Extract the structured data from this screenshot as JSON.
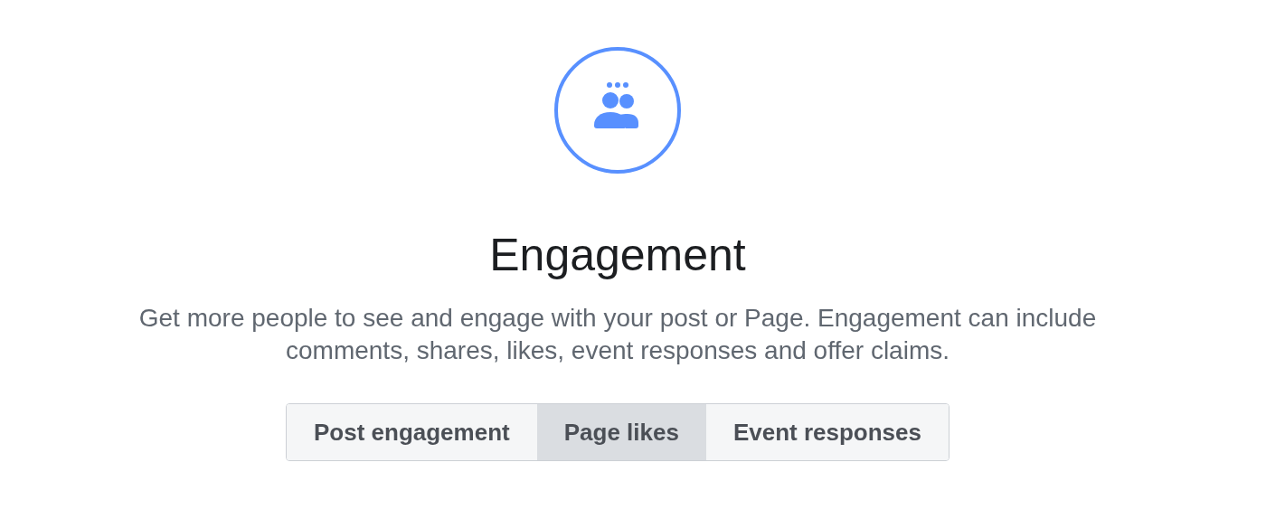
{
  "title": "Engagement",
  "description": "Get more people to see and engage with your post or Page. Engagement can include comments, shares, likes, event responses and offer claims.",
  "options": [
    {
      "label": "Post engagement",
      "selected": false
    },
    {
      "label": "Page likes",
      "selected": true
    },
    {
      "label": "Event responses",
      "selected": false
    }
  ]
}
